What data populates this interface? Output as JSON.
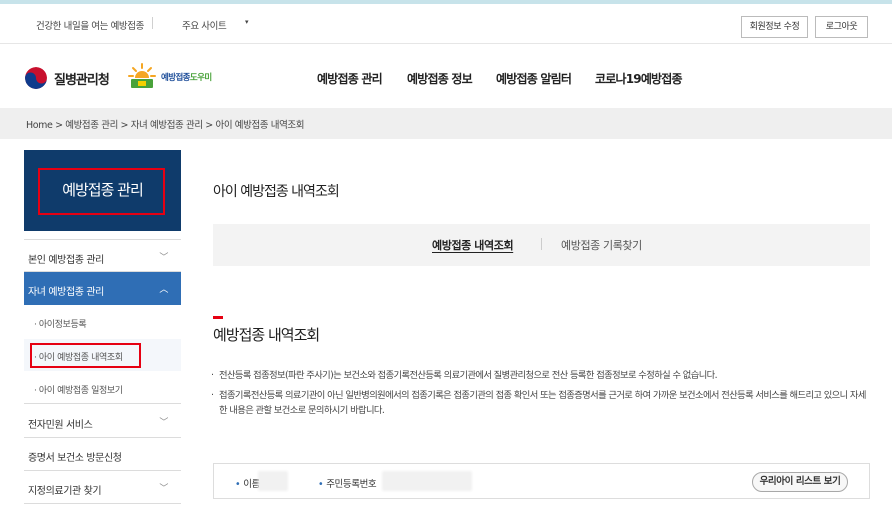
{
  "utility": {
    "tagline": "건강한 내일을 여는 예방접종",
    "sites": "주요 사이트",
    "caret": "▾",
    "edit_info": "회원정보 수정",
    "logout": "로그아웃"
  },
  "brand": {
    "kdca": "질병관리청",
    "portal_a": "예방접종",
    "portal_b": "도우미"
  },
  "gnb": [
    "예방접종 관리",
    "예방접종 정보",
    "예방접종 알림터",
    "코로나19예방접종"
  ],
  "breadcrumb": "Home > 예방접종 관리 > 자녀 예방접종 관리 > 아이 예방접종 내역조회",
  "sidebar": {
    "title": "예방접종 관리",
    "chevron_down": "﹀",
    "chevron_up": "︿",
    "items": [
      {
        "label": "본인 예방접종 관리"
      },
      {
        "label": "자녀 예방접종 관리"
      },
      {
        "label": "전자민원 서비스"
      },
      {
        "label": "증명서 보건소 방문신청"
      },
      {
        "label": "지정의료기관 찾기"
      }
    ],
    "subitems": [
      {
        "label": "· 아이정보등록"
      },
      {
        "label": "· 아이 예방접종 내역조회"
      },
      {
        "label": "· 아이 예방접종 일정보기"
      }
    ]
  },
  "main": {
    "page_title": "아이 예방접종 내역조회",
    "tabs": [
      "예방접종 내역조회",
      "예방접종 기록찾기"
    ],
    "section_title": "예방접종 내역조회",
    "notes": [
      "전산등록 접종정보(파란 주사기)는 보건소와 접종기록전산등록 의료기관에서 질병관리청으로 전산 등록한 접종정보로 수정하실 수 없습니다.",
      "접종기록전산등록 의료기관이 아닌 일반병의원에서의 접종기록은 접종기관의 접종 확인서 또는 접종증명서를 근거로 하여 가까운 보건소에서 전산등록 서비스를 해드리고 있으니 자세한 내용은 관할 보건소로 문의하시기 바랍니다."
    ],
    "note_dot": "·",
    "bullet": "•",
    "name_label": "이름",
    "rrn_label": "주민등록번호",
    "list_button": "우리아이 리스트 보기"
  }
}
